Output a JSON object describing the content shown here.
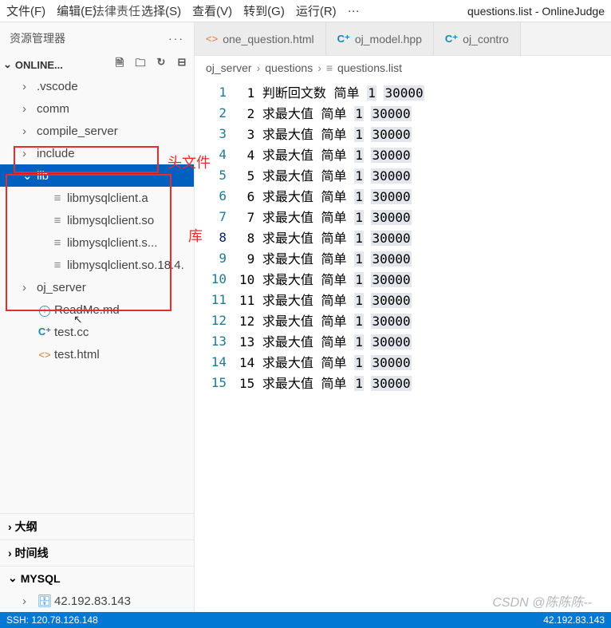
{
  "menubar": {
    "items": [
      "文件(F)",
      "编辑(E)",
      "选择(S)",
      "查看(V)",
      "转到(G)",
      "运行(R)"
    ],
    "legal": "法律责任",
    "title": "questions.list - OnlineJudge"
  },
  "sidebar": {
    "title": "资源管理器",
    "dots": "···",
    "project": "ONLINE...",
    "toolbar_icons": [
      "new-file-icon",
      "new-folder-icon",
      "refresh-icon",
      "collapse-icon"
    ],
    "tree": [
      {
        "type": "folder",
        "name": ".vscode",
        "indent": 1
      },
      {
        "type": "folder",
        "name": "comm",
        "indent": 1
      },
      {
        "type": "folder",
        "name": "compile_server",
        "indent": 1
      },
      {
        "type": "folder",
        "name": "include",
        "indent": 1
      },
      {
        "type": "folder",
        "name": "lib",
        "indent": 1,
        "expanded": true,
        "selected": true
      },
      {
        "type": "file",
        "name": "libmysqlclient.a",
        "indent": 2,
        "icon": "file"
      },
      {
        "type": "file",
        "name": "libmysqlclient.so",
        "indent": 2,
        "icon": "file"
      },
      {
        "type": "file",
        "name": "libmysqlclient.s...",
        "indent": 2,
        "icon": "file"
      },
      {
        "type": "file",
        "name": "libmysqlclient.so.18.4.",
        "indent": 2,
        "icon": "file"
      },
      {
        "type": "folder",
        "name": "oj_server",
        "indent": 1
      },
      {
        "type": "file",
        "name": "ReadMe.md",
        "indent": 1,
        "icon": "md"
      },
      {
        "type": "file",
        "name": "test.cc",
        "indent": 1,
        "icon": "cpp"
      },
      {
        "type": "file",
        "name": "test.html",
        "indent": 1,
        "icon": "html"
      }
    ],
    "sections": [
      {
        "label": "大纲",
        "expanded": false
      },
      {
        "label": "时间线",
        "expanded": false
      },
      {
        "label": "MYSQL",
        "expanded": true,
        "children": [
          {
            "label": "42.192.83.143",
            "icon": "db"
          }
        ]
      }
    ]
  },
  "annotations": {
    "header_label": "头文件",
    "lib_label": "库"
  },
  "tabs": [
    {
      "icon": "html",
      "label": "one_question.html"
    },
    {
      "icon": "cpp",
      "label": "oj_model.hpp"
    },
    {
      "icon": "cpp",
      "label": "oj_contro"
    }
  ],
  "breadcrumb": [
    "oj_server",
    "questions",
    "questions.list"
  ],
  "bc_icon_name": "list-icon",
  "editor_lines": [
    {
      "num": 1,
      "idx": "1",
      "title": "判断回文数",
      "diff": "简单",
      "a": "1",
      "b": "30000"
    },
    {
      "num": 2,
      "idx": "2",
      "title": "求最大值",
      "diff": "简单",
      "a": "1",
      "b": "30000"
    },
    {
      "num": 3,
      "idx": "3",
      "title": "求最大值",
      "diff": "简单",
      "a": "1",
      "b": "30000"
    },
    {
      "num": 4,
      "idx": "4",
      "title": "求最大值",
      "diff": "简单",
      "a": "1",
      "b": "30000"
    },
    {
      "num": 5,
      "idx": "5",
      "title": "求最大值",
      "diff": "简单",
      "a": "1",
      "b": "30000"
    },
    {
      "num": 6,
      "idx": "6",
      "title": "求最大值",
      "diff": "简单",
      "a": "1",
      "b": "30000"
    },
    {
      "num": 7,
      "idx": "7",
      "title": "求最大值",
      "diff": "简单",
      "a": "1",
      "b": "30000"
    },
    {
      "num": 8,
      "idx": "8",
      "title": "求最大值",
      "diff": "简单",
      "a": "1",
      "b": "30000"
    },
    {
      "num": 9,
      "idx": "9",
      "title": "求最大值",
      "diff": "简单",
      "a": "1",
      "b": "30000"
    },
    {
      "num": 10,
      "idx": "10",
      "title": "求最大值",
      "diff": "简单",
      "a": "1",
      "b": "30000"
    },
    {
      "num": 11,
      "idx": "11",
      "title": "求最大值",
      "diff": "简单",
      "a": "1",
      "b": "30000"
    },
    {
      "num": 12,
      "idx": "12",
      "title": "求最大值",
      "diff": "简单",
      "a": "1",
      "b": "30000"
    },
    {
      "num": 13,
      "idx": "13",
      "title": "求最大值",
      "diff": "简单",
      "a": "1",
      "b": "30000"
    },
    {
      "num": 14,
      "idx": "14",
      "title": "求最大值",
      "diff": "简单",
      "a": "1",
      "b": "30000"
    },
    {
      "num": 15,
      "idx": "15",
      "title": "求最大值",
      "diff": "简单",
      "a": "1",
      "b": "30000"
    }
  ],
  "active_line": 8,
  "statusbar": {
    "left": "SSH: 120.78.126.148",
    "right": "42.192.83.143"
  },
  "watermark": "CSDN @陈陈陈--"
}
